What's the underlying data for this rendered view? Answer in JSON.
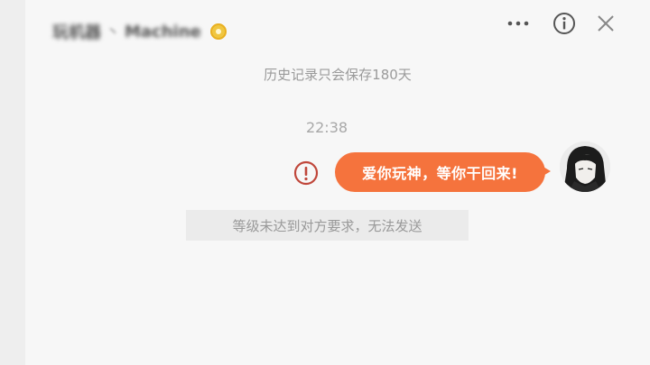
{
  "header": {
    "contact_prefix": "玩机器",
    "contact_sep": "丶",
    "contact_name": "Machine",
    "badge_icon": "vip-badge-icon",
    "more_icon": "more-dots-icon",
    "info_icon": "info-icon",
    "close_icon": "close-icon"
  },
  "chat": {
    "history_note": "历史记录只会保存180天",
    "timestamp": "22:38",
    "message_text": "爱你玩神，等你干回来!",
    "send_error_icon": "alert-circle-icon",
    "system_notice": "等级未达到对方要求，无法发送"
  },
  "colors": {
    "bubble": "#f5733d",
    "error": "#c0473b",
    "badge": "#f0c640"
  }
}
